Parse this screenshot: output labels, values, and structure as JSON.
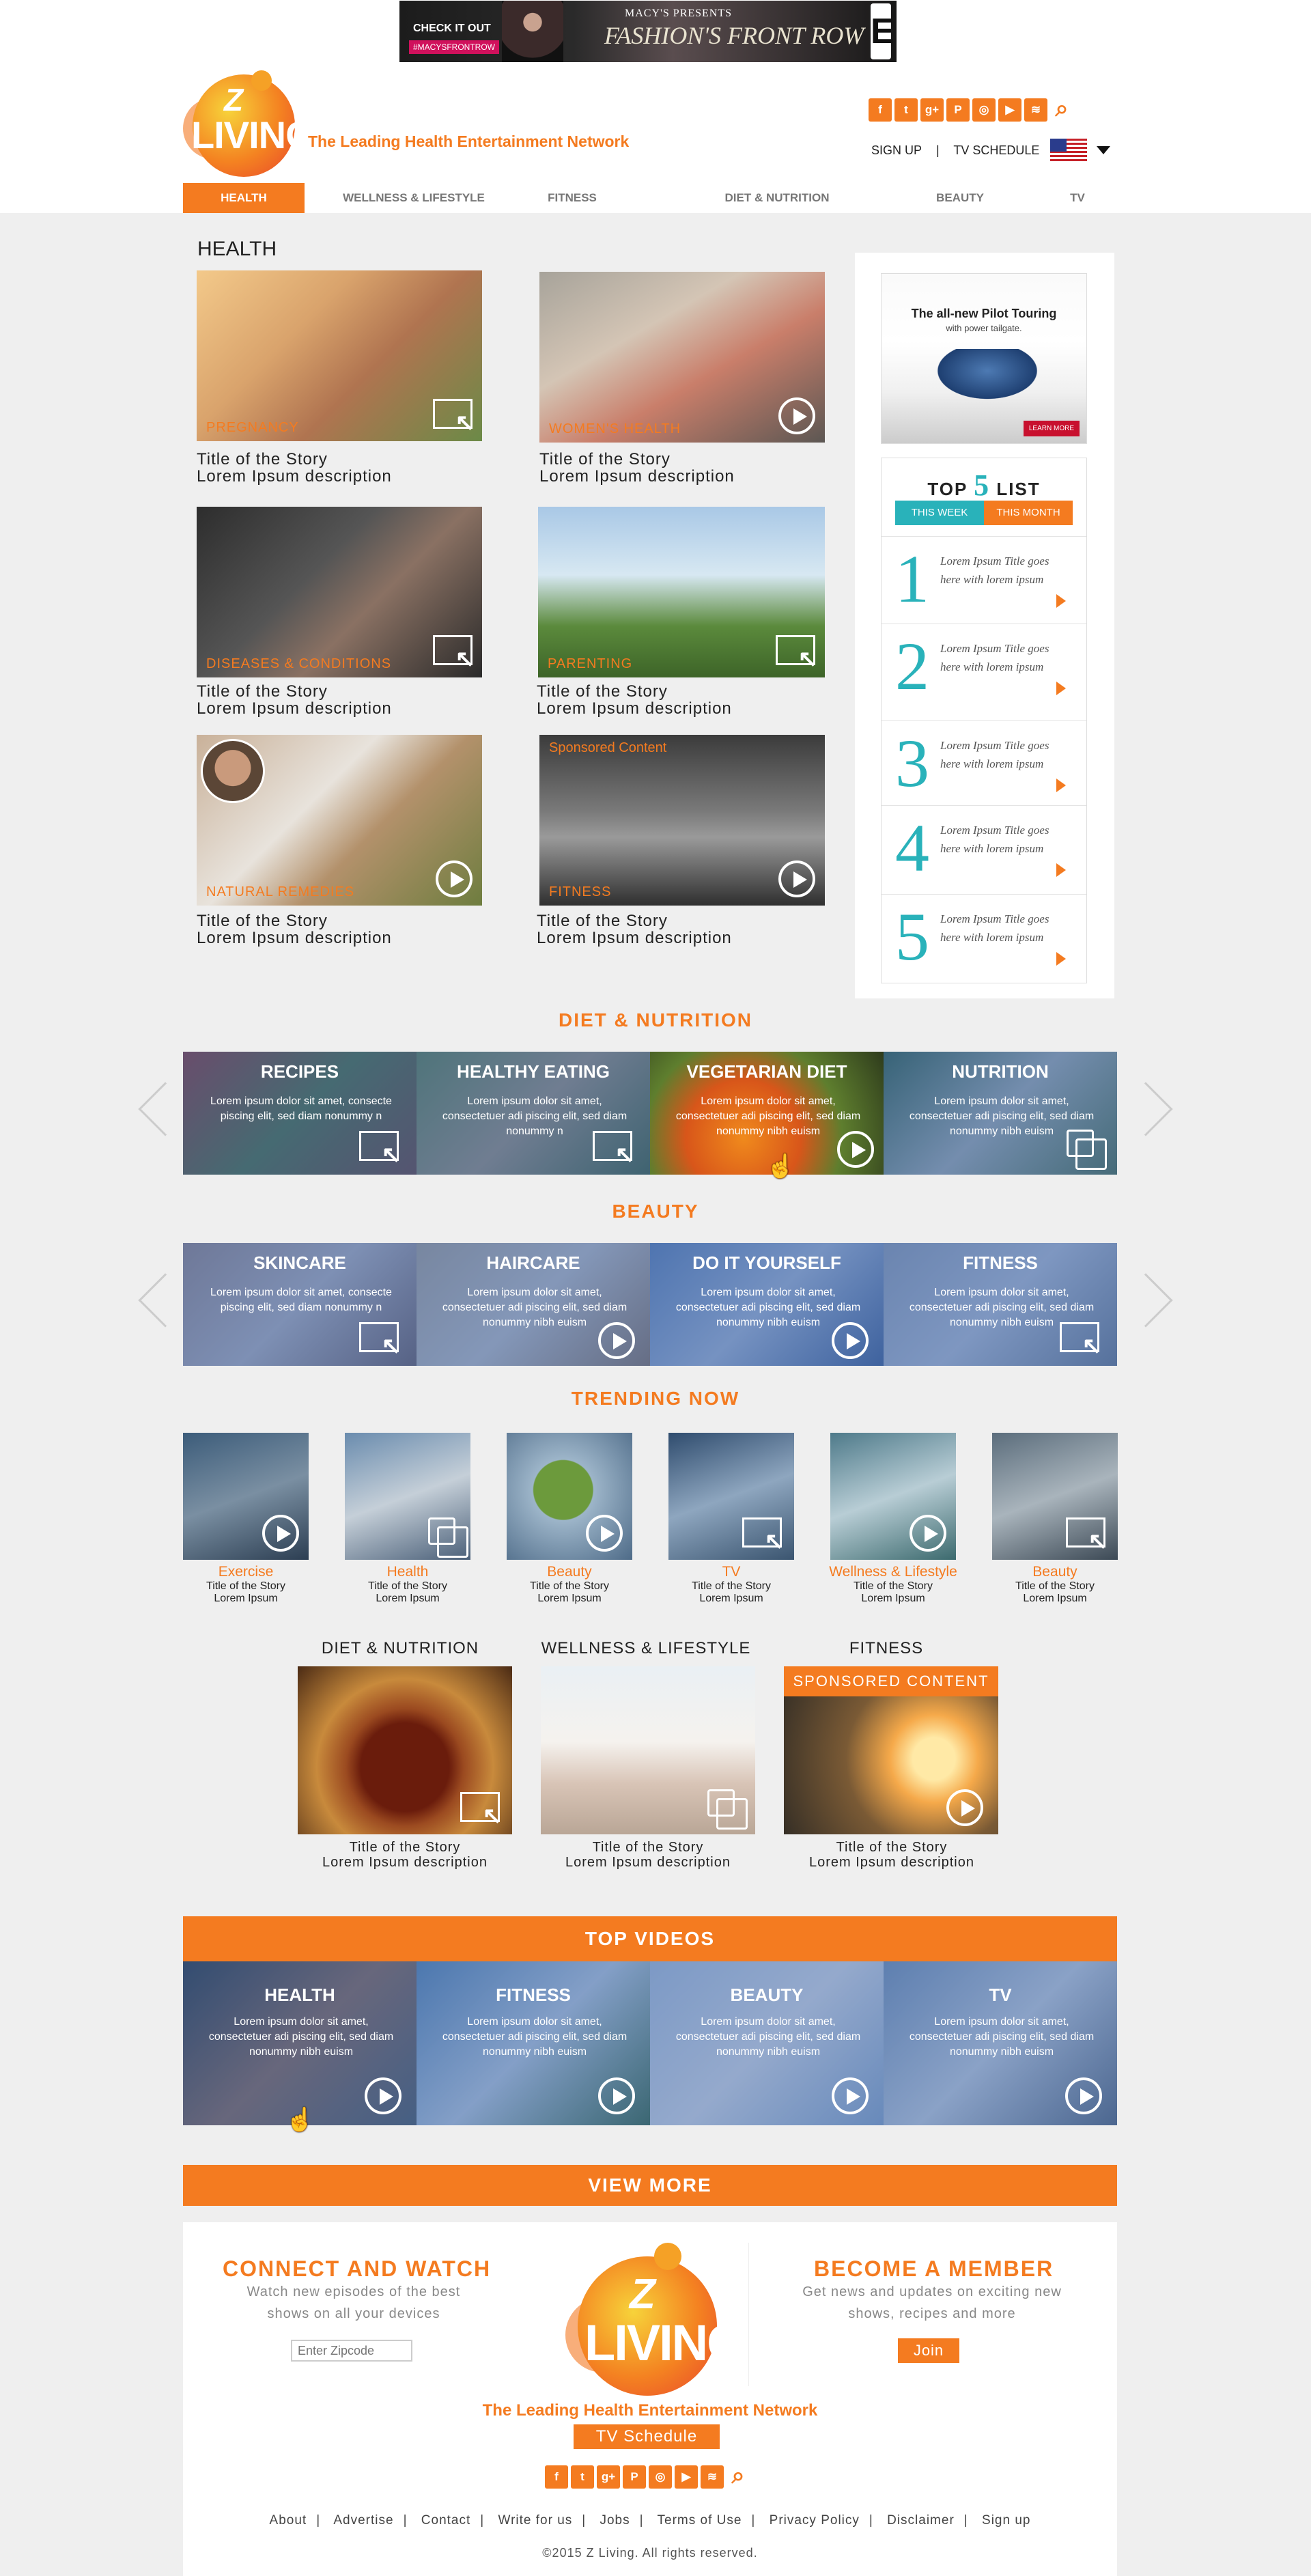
{
  "ad_banner": {
    "check_label": "CHECK IT OUT",
    "hashtag": "#MACYSFRONTROW",
    "presenter": "MACY'S PRESENTS",
    "headline": "FASHION'S FRONT ROW",
    "network_mark": "E"
  },
  "brand": {
    "logo_z": "Z",
    "logo_word": "LIVING",
    "tagline": "The Leading Health Entertainment Network",
    "accent_color": "#f47b20",
    "teal_color": "#29b2ba"
  },
  "header": {
    "social_icons": [
      "facebook-icon",
      "twitter-icon",
      "google-plus-icon",
      "pinterest-icon",
      "instagram-icon",
      "youtube-icon",
      "rss-icon"
    ],
    "social_glyphs": [
      "f",
      "t",
      "g+",
      "P",
      "◎",
      "▶",
      "≋"
    ],
    "search_glyph": "⌕",
    "sign_up": "SIGN UP",
    "divider": "|",
    "tv_schedule": "TV SCHEDULE"
  },
  "nav": [
    "HEALTH",
    "WELLNESS & LIFESTYLE",
    "FITNESS",
    "DIET & NUTRITION",
    "BEAUTY",
    "TV"
  ],
  "health": {
    "title": "HEALTH",
    "cards": [
      {
        "category": "PREGNANCY",
        "title": "Title of the Story",
        "desc": "Lorem Ipsum description"
      },
      {
        "category": "WOMEN'S HEALTH",
        "title": "Title of the Story",
        "desc": "Lorem Ipsum description"
      },
      {
        "category": "DISEASES & CONDITIONS",
        "title": "Title of the Story",
        "desc": "Lorem Ipsum description"
      },
      {
        "category": "PARENTING",
        "title": "Title of the Story",
        "desc": "Lorem Ipsum description"
      },
      {
        "category": "NATURAL REMEDIES",
        "title": "Title of the Story",
        "desc": "Lorem Ipsum description"
      },
      {
        "category": "FITNESS",
        "sponsored": "Sponsored Content",
        "title": "Title of the Story",
        "desc": "Lorem Ipsum description"
      }
    ]
  },
  "sidebar": {
    "ad_headline": "The all-new Pilot Touring",
    "ad_sub": "with power tailgate.",
    "ad_button": "LEARN MORE",
    "top5_prefix": "TOP",
    "top5_number": "5",
    "top5_suffix": "LIST",
    "tab_week": "THIS WEEK",
    "tab_month": "THIS MONTH",
    "items": [
      {
        "num": "1",
        "text": "Lorem Ipsum Title goes here with lorem ipsum"
      },
      {
        "num": "2",
        "text": "Lorem Ipsum Title goes here with lorem ipsum"
      },
      {
        "num": "3",
        "text": "Lorem Ipsum Title goes here with lorem ipsum"
      },
      {
        "num": "4",
        "text": "Lorem Ipsum Title goes here with lorem ipsum"
      },
      {
        "num": "5",
        "text": "Lorem Ipsum Title goes here with lorem ipsum"
      }
    ]
  },
  "diet": {
    "title": "DIET & NUTRITION",
    "slides": [
      {
        "title": "RECIPES",
        "desc": "Lorem ipsum dolor sit amet, consecte piscing elit, sed diam nonummy n"
      },
      {
        "title": "HEALTHY EATING",
        "desc": "Lorem ipsum dolor sit amet, consectetuer adi piscing elit, sed diam nonummy n"
      },
      {
        "title": "VEGETARIAN DIET",
        "desc": "Lorem ipsum dolor sit amet, consectetuer adi piscing elit, sed diam nonummy nibh euism"
      },
      {
        "title": "NUTRITION",
        "desc": "Lorem ipsum dolor sit amet, consectetuer adi piscing elit, sed diam nonummy nibh euism"
      }
    ]
  },
  "beauty": {
    "title": "BEAUTY",
    "slides": [
      {
        "title": "SKINCARE",
        "desc": "Lorem ipsum dolor sit amet, consecte piscing elit, sed diam nonummy n"
      },
      {
        "title": "HAIRCARE",
        "desc": "Lorem ipsum dolor sit amet, consectetuer adi piscing elit, sed diam nonummy nibh euism"
      },
      {
        "title": "DO IT YOURSELF",
        "desc": "Lorem ipsum dolor sit amet, consectetuer adi piscing elit, sed diam nonummy nibh euism"
      },
      {
        "title": "FITNESS",
        "desc": "Lorem ipsum dolor sit amet, consectetuer adi piscing elit, sed diam nonummy nibh euism"
      }
    ]
  },
  "trending": {
    "title": "TRENDING NOW",
    "items": [
      {
        "category": "Exercise",
        "title": "Title of the Story",
        "desc": "Lorem Ipsum"
      },
      {
        "category": "Health",
        "title": "Title of the Story",
        "desc": "Lorem Ipsum"
      },
      {
        "category": "Beauty",
        "title": "Title of the Story",
        "desc": "Lorem Ipsum"
      },
      {
        "category": "TV",
        "title": "Title of the Story",
        "desc": "Lorem Ipsum"
      },
      {
        "category": "Wellness & Lifestyle",
        "title": "Title of the Story",
        "desc": "Lorem Ipsum"
      },
      {
        "category": "Beauty",
        "title": "Title of the Story",
        "desc": "Lorem Ipsum"
      }
    ]
  },
  "featured": [
    {
      "heading": "DIET & NUTRITION",
      "title": "Title of the Story",
      "desc": "Lorem Ipsum description"
    },
    {
      "heading": "WELLNESS & LIFESTYLE",
      "title": "Title of the Story",
      "desc": "Lorem Ipsum description"
    },
    {
      "heading": "FITNESS",
      "sponsored": "SPONSORED CONTENT",
      "title": "Title of the Story",
      "desc": "Lorem Ipsum description"
    }
  ],
  "top_videos": {
    "title": "TOP VIDEOS",
    "slides": [
      {
        "title": "HEALTH",
        "desc": "Lorem ipsum dolor sit amet, consectetuer adi piscing elit, sed diam nonummy nibh euism"
      },
      {
        "title": "FITNESS",
        "desc": "Lorem ipsum dolor sit amet, consectetuer adi piscing elit, sed diam nonummy nibh euism"
      },
      {
        "title": "BEAUTY",
        "desc": "Lorem ipsum dolor sit amet, consectetuer adi piscing elit, sed diam nonummy nibh euism"
      },
      {
        "title": "TV",
        "desc": "Lorem ipsum dolor sit amet, consectetuer adi piscing elit, sed diam nonummy nibh euism"
      }
    ]
  },
  "view_more": "VIEW MORE",
  "footer": {
    "connect_title": "CONNECT AND WATCH",
    "connect_sub": "Watch new episodes of the best shows on all your devices",
    "zip_placeholder": "Enter Zipcode",
    "member_title": "BECOME A MEMBER",
    "member_sub": "Get news and updates on exciting new shows, recipes and more",
    "join": "Join",
    "tagline": "The Leading Health Entertainment Network",
    "tv_schedule": "TV Schedule",
    "links": [
      "About",
      "Advertise",
      "Contact",
      "Write for us",
      "Jobs",
      "Terms of Use",
      "Privacy Policy",
      "Disclaimer",
      "Sign up"
    ],
    "copyright": "©2015 Z Living. All rights reserved."
  }
}
